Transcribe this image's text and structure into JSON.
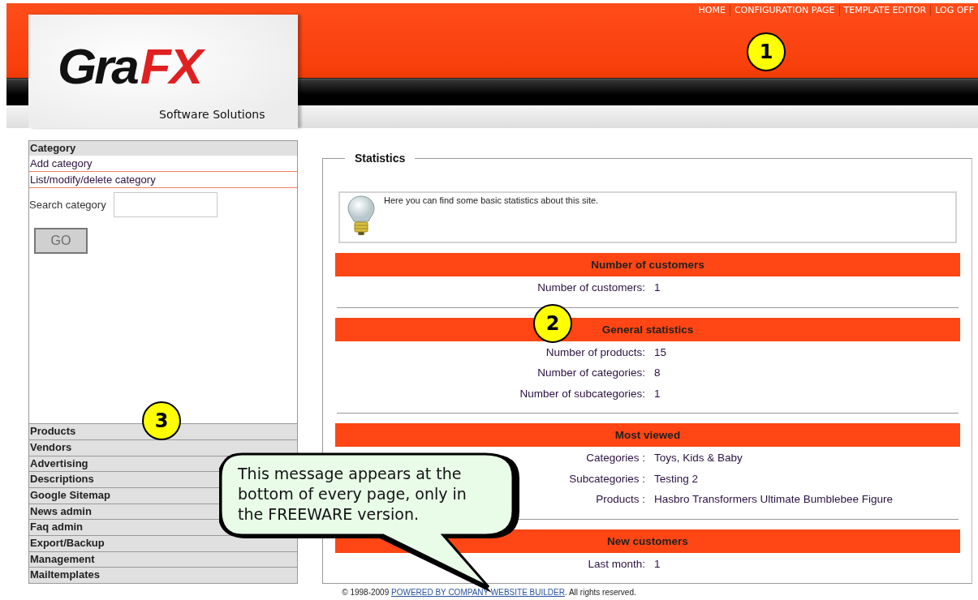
{
  "header": {
    "nav": [
      "HOME",
      "CONFIGURATION PAGE",
      "TEMPLATE EDITOR",
      "LOG OFF"
    ],
    "logo": {
      "wordmark_start": "Gra",
      "wordmark_end": "FX",
      "tagline": "Software Solutions"
    }
  },
  "sidebar": {
    "title": "Category",
    "links": [
      "Add category",
      "List/modify/delete category"
    ],
    "search": {
      "label": "Search category"
    },
    "button": {
      "label": "GO",
      "disabled": true
    },
    "menu": [
      "Products",
      "Vendors",
      "Advertising",
      "Descriptions",
      "Google Sitemap",
      "News admin",
      "Faq admin",
      "Export/Backup",
      "Management",
      "Mailtemplates"
    ]
  },
  "statistics": {
    "title": "Statistics",
    "info": "Here you can find some basic statistics about this site.",
    "sections": [
      {
        "title": "Number of customers",
        "rows": [
          {
            "label": "Number of customers:",
            "value": "1"
          }
        ]
      },
      {
        "title": "General statistics",
        "rows": [
          {
            "label": "Number of products:",
            "value": "15"
          },
          {
            "label": "Number of categories:",
            "value": "8"
          },
          {
            "label": "Number of subcategories:",
            "value": "1"
          }
        ]
      },
      {
        "title": "Most viewed",
        "rows": [
          {
            "label": "Categories :",
            "value": "Toys, Kids & Baby"
          },
          {
            "label": "Subcategories :",
            "value": "Testing 2"
          },
          {
            "label": "Products :",
            "value": "Hasbro Transformers Ultimate Bumblebee Figure"
          }
        ]
      },
      {
        "title": "New customers",
        "rows": [
          {
            "label": "Last month:",
            "value": "1"
          }
        ]
      }
    ]
  },
  "footer": {
    "before": "© 1998-2009 ",
    "link": "POWERED BY COMPANY WEBSITE BUILDER",
    "after": ". All rights reserved."
  },
  "annotations": {
    "markers": [
      {
        "number": "1"
      },
      {
        "number": "2"
      },
      {
        "number": "3"
      }
    ],
    "callout": "This message appears at the bottom of every page, only in the FREEWARE version."
  }
}
